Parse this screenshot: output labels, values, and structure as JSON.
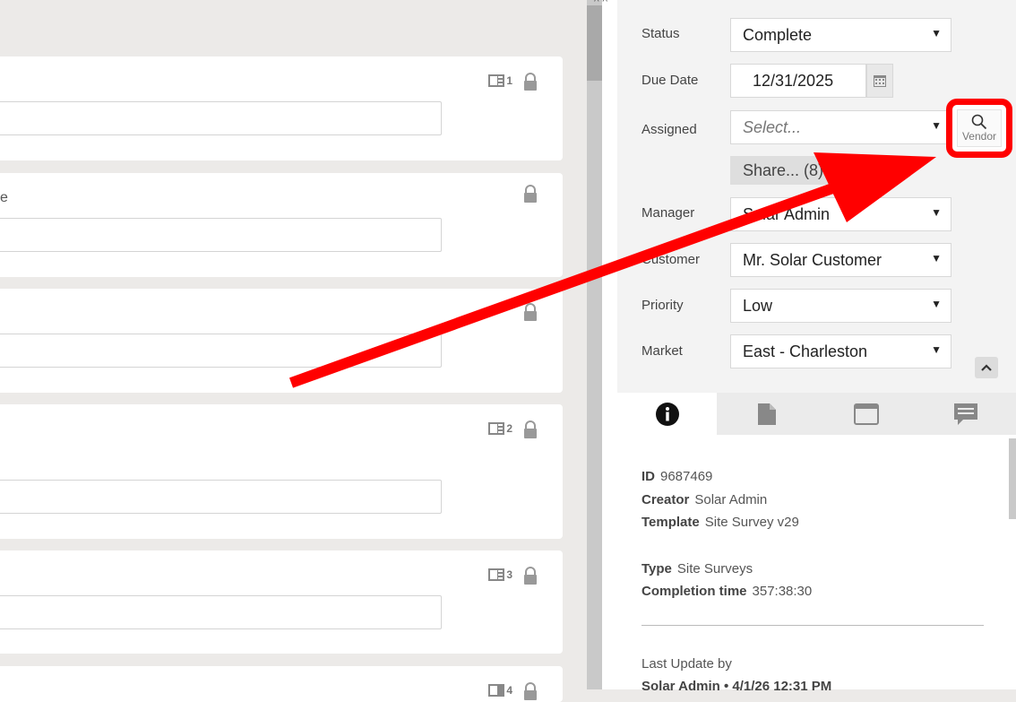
{
  "cards": [
    {
      "doc_count": "1",
      "has_lock": true
    },
    {
      "label_fragment": "e",
      "has_lock": true
    },
    {
      "has_lock": true
    },
    {
      "doc_count": "2",
      "has_lock": true
    },
    {
      "doc_count": "3",
      "has_lock": true
    },
    {
      "doc_count": "4",
      "has_lock": true
    }
  ],
  "properties": {
    "status_label": "Status",
    "status_value": "Complete",
    "due_date_label": "Due Date",
    "due_date_value": "12/31/2025",
    "assigned_label": "Assigned",
    "assigned_placeholder": "Select...",
    "vendor_label": "Vendor",
    "share_label": "Share... (8)",
    "manager_label": "Manager",
    "manager_value": "Solar Admin",
    "customer_label": "Customer",
    "customer_value": "Mr. Solar Customer",
    "priority_label": "Priority",
    "priority_value": "Low",
    "market_label": "Market",
    "market_value": "East - Charleston"
  },
  "tabs": [
    "info-icon",
    "document-icon",
    "window-icon",
    "comment-icon"
  ],
  "info": {
    "id_label": "ID",
    "id_value": "9687469",
    "creator_label": "Creator",
    "creator_value": "Solar Admin",
    "template_label": "Template",
    "template_value": "Site Survey v29",
    "type_label": "Type",
    "type_value": "Site Surveys",
    "completion_label": "Completion time",
    "completion_value": "357:38:30",
    "last_update_label": "Last Update by",
    "last_update_value": "Solar Admin • 4/1/26 12:31 PM"
  },
  "colors": {
    "annotation": "#ff0000",
    "background": "#eceae8",
    "panel": "#f3f3f3"
  }
}
